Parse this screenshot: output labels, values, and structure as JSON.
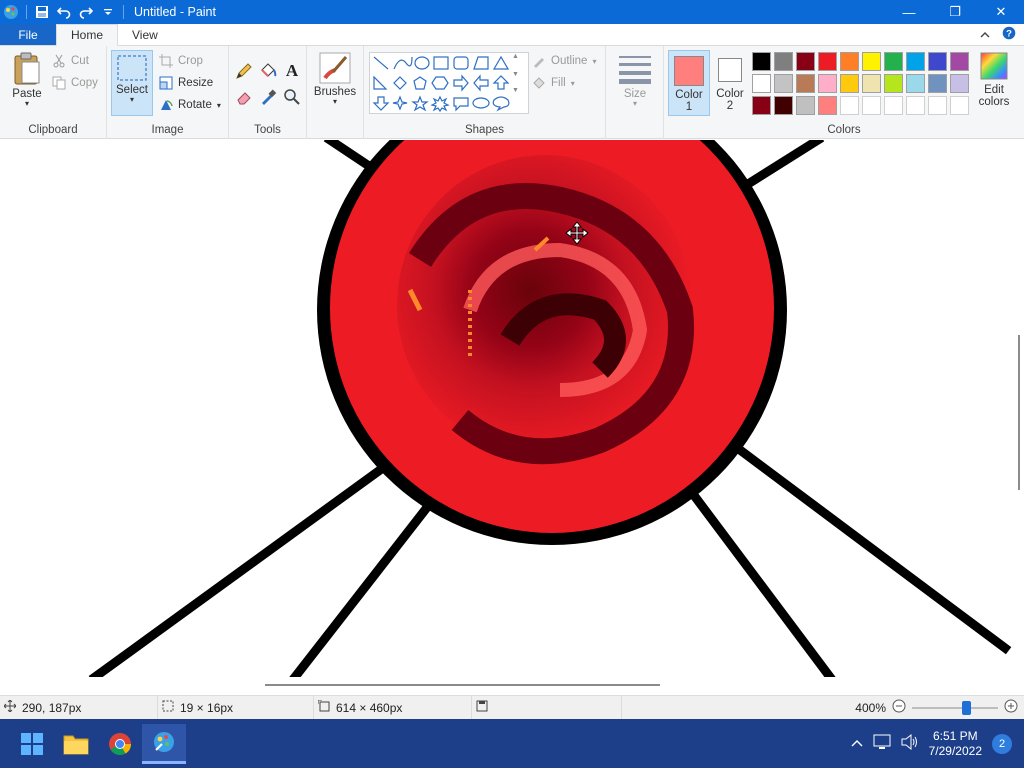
{
  "window": {
    "title": "Untitled - Paint",
    "controls": {
      "minimize": "—",
      "maximize": "❐",
      "close": "✕"
    }
  },
  "tabs": {
    "file": "File",
    "home": "Home",
    "view": "View"
  },
  "ribbon": {
    "clipboard": {
      "label": "Clipboard",
      "paste": "Paste",
      "cut": "Cut",
      "copy": "Copy"
    },
    "image": {
      "label": "Image",
      "select": "Select",
      "crop": "Crop",
      "resize": "Resize",
      "rotate": "Rotate"
    },
    "tools": {
      "label": "Tools"
    },
    "brushes": {
      "label": "Brushes"
    },
    "shapes": {
      "label": "Shapes",
      "outline": "Outline",
      "fill": "Fill"
    },
    "size": {
      "label": "Size"
    },
    "colors": {
      "label": "Colors",
      "color1": "Color",
      "color1_num": "1",
      "color2": "Color",
      "color2_num": "2",
      "color1_value": "#ff7f7f",
      "color2_value": "#ffffff",
      "edit": "Edit",
      "edit2": "colors",
      "palette_row1": [
        "#000000",
        "#7f7f7f",
        "#880015",
        "#ed1c24",
        "#ff7f27",
        "#fff200",
        "#22b14c",
        "#00a2e8",
        "#3f48cc",
        "#a349a4"
      ],
      "palette_row2": [
        "#ffffff",
        "#c3c3c3",
        "#b97a57",
        "#ffaec9",
        "#ffc90e",
        "#efe4b0",
        "#b5e61d",
        "#99d9ea",
        "#7092be",
        "#c8bfe7"
      ],
      "palette_row3": [
        "#880015",
        "#400000",
        "#c0c0c0",
        "#ff7f7f",
        "#ffffff",
        "#ffffff",
        "#ffffff",
        "#ffffff",
        "#ffffff",
        "#ffffff"
      ]
    }
  },
  "status": {
    "cursor_pos": "290, 187px",
    "selection_size": "19 × 16px",
    "image_size": "614 × 460px",
    "zoom": "400%",
    "zoom_level_percent": 65
  },
  "taskbar": {
    "time": "6:51 PM",
    "date": "7/29/2022",
    "notifications": "2"
  }
}
